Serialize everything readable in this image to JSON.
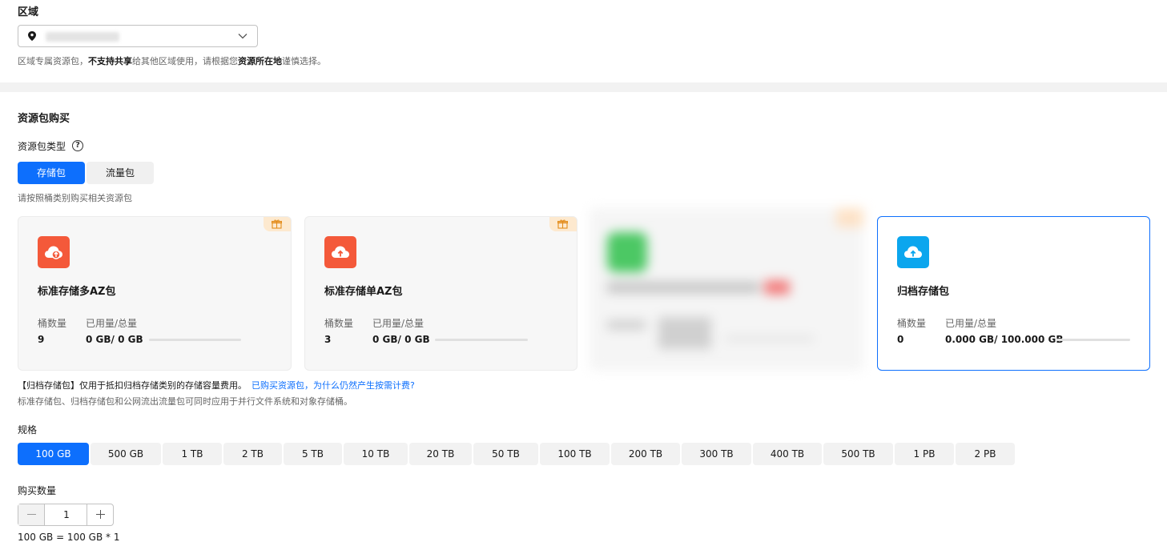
{
  "region": {
    "label": "区域",
    "select_value": "",
    "hint_part1": "区域专属资源包，",
    "hint_bold1": "不支持共享",
    "hint_part2": "给其他区域使用，请根据您",
    "hint_bold2": "资源所在地",
    "hint_part3": "谨慎选择。"
  },
  "purchase": {
    "section_title": "资源包购买",
    "type_label": "资源包类型",
    "type_help": "?",
    "type_tabs": [
      "存储包",
      "流量包"
    ],
    "type_hint": "请按照桶类别购买相关资源包",
    "cards": [
      {
        "title": "标准存储多AZ包",
        "bucket_label": "桶数量",
        "usage_label": "已用量/总量",
        "bucket_count": "9",
        "usage": "0 GB/ 0 GB",
        "icon": "cloud-upload-icon",
        "color": "#f4593a",
        "has_gift": true
      },
      {
        "title": "标准存储单AZ包",
        "bucket_label": "桶数量",
        "usage_label": "已用量/总量",
        "bucket_count": "3",
        "usage": "0 GB/ 0 GB",
        "icon": "cloud-upload-icon",
        "color": "#f4593a",
        "has_gift": true
      },
      {
        "title": "归档存储包",
        "bucket_label": "桶数量",
        "usage_label": "已用量/总量",
        "bucket_count": "0",
        "usage": "0.000 GB/ 100.000 GB",
        "icon": "cloud-upload-icon",
        "color": "#0ba6ee",
        "has_gift": false
      }
    ],
    "note_main": "【归档存储包】仅用于抵扣归档存储类别的存储容量费用。",
    "note_link": "已购买资源包，为什么仍然产生按需计费?",
    "note_sub": "标准存储包、归档存储包和公网流出流量包可同时应用于并行文件系统和对象存储桶。",
    "spec_label": "规格",
    "specs": [
      "100 GB",
      "500 GB",
      "1 TB",
      "2 TB",
      "5 TB",
      "10 TB",
      "20 TB",
      "50 TB",
      "100 TB",
      "200 TB",
      "300 TB",
      "400 TB",
      "500 TB",
      "1 PB",
      "2 PB"
    ],
    "selected_spec": "100 GB",
    "quantity_label": "购买数量",
    "quantity": "1",
    "formula": "100 GB = 100 GB * 1"
  },
  "colors": {
    "accent": "#0d6ffd",
    "card_icon_orange": "#f4593a",
    "card_icon_blue": "#0ba6ee",
    "gift_bg": "#fde9cf"
  }
}
